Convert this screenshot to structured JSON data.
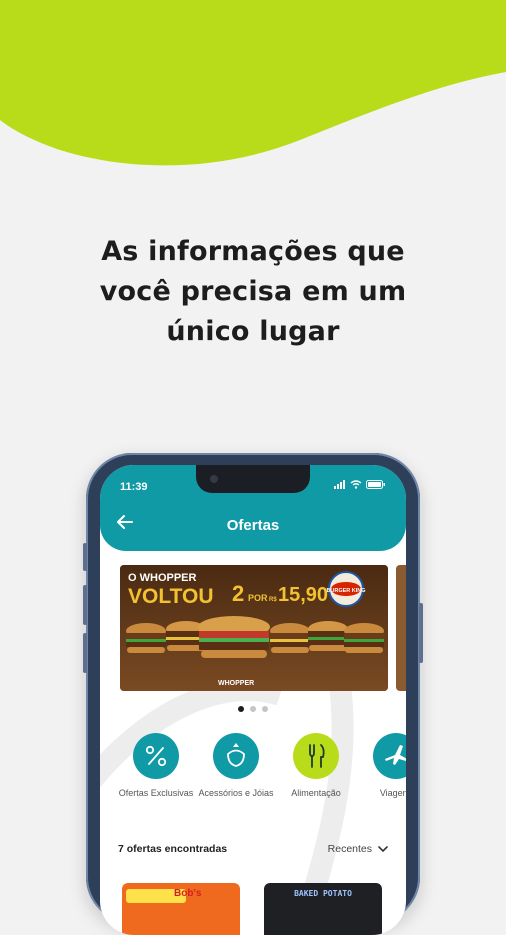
{
  "headline": {
    "line1": "As informações que",
    "line2": "você precisa em um",
    "line3": "único lugar"
  },
  "colors": {
    "lime": "#b9dc1a",
    "teal": "#0f9aa6",
    "background": "#f2f2f2"
  },
  "phone": {
    "status_time": "11:39",
    "title": "Ofertas",
    "banner": {
      "line1": "O WHOPPER",
      "line2": "VOLTOU",
      "offer_qty": "2",
      "offer_por": "POR",
      "offer_currency": "R$",
      "offer_price": "15,90",
      "brand": "BURGER KING",
      "footer": "WHOPPER"
    },
    "carousel_pages": 3,
    "carousel_active": 1,
    "categories": [
      {
        "label": "Ofertas Exclusivas",
        "icon": "percent-icon"
      },
      {
        "label": "Acessórios e Jóias",
        "icon": "ring-icon"
      },
      {
        "label": "Alimentação",
        "icon": "fork-knife-icon"
      },
      {
        "label": "Viagens",
        "icon": "airplane-icon"
      }
    ],
    "offers_count": "7 ofertas encontradas",
    "sort_label": "Recentes",
    "cards": [
      {
        "label": "Bob's"
      },
      {
        "label": "BAKED POTATO"
      }
    ]
  }
}
